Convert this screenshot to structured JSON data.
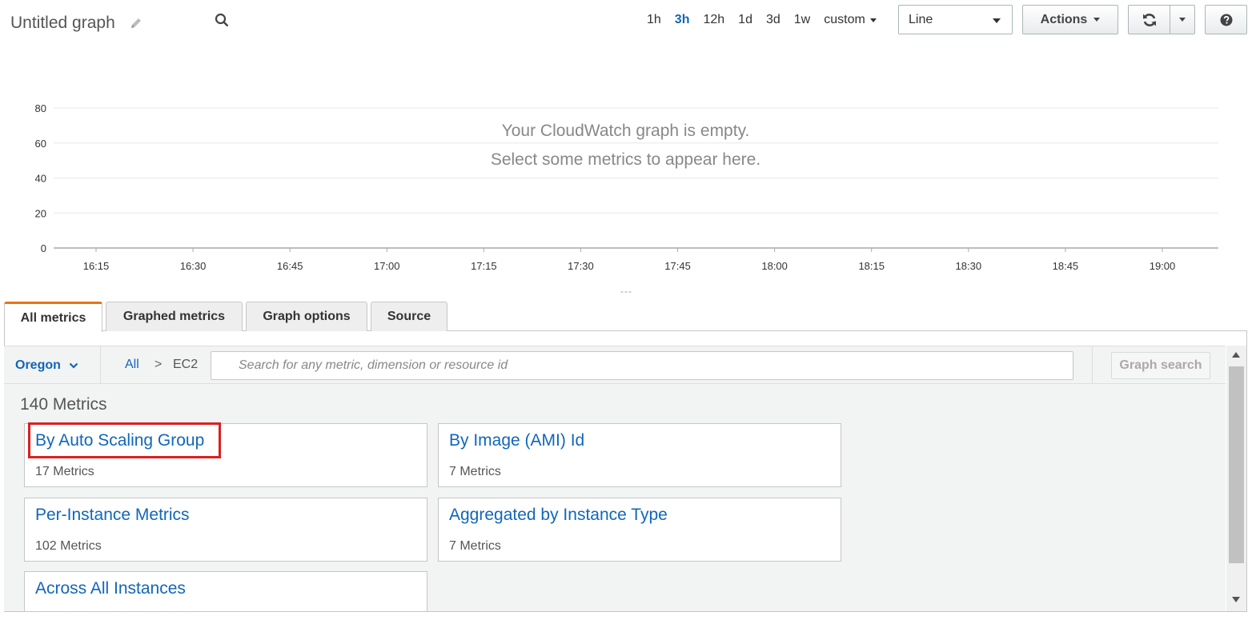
{
  "header": {
    "title": "Untitled graph",
    "time_ranges": [
      "1h",
      "3h",
      "12h",
      "1d",
      "3d",
      "1w"
    ],
    "active_range": "3h",
    "custom_label": "custom",
    "graph_type": "Line",
    "actions_label": "Actions"
  },
  "chart": {
    "empty_line1": "Your CloudWatch graph is empty.",
    "empty_line2": "Select some metrics to appear here.",
    "y_ticks": [
      "80",
      "60",
      "40",
      "20",
      "0"
    ],
    "x_ticks": [
      "16:15",
      "16:30",
      "16:45",
      "17:00",
      "17:15",
      "17:30",
      "17:45",
      "18:00",
      "18:15",
      "18:30",
      "18:45",
      "19:00"
    ],
    "drag_handle": "---"
  },
  "tabs": [
    "All metrics",
    "Graphed metrics",
    "Graph options",
    "Source"
  ],
  "toolbar": {
    "region": "Oregon",
    "crumb_all": "All",
    "crumb_sep": ">",
    "crumb_current": "EC2",
    "search_placeholder": "Search for any metric, dimension or resource id",
    "graph_search": "Graph search"
  },
  "metrics": {
    "count": "140 Metrics",
    "cards": [
      {
        "title": "By Auto Scaling Group",
        "sub": "17 Metrics"
      },
      {
        "title": "By Image (AMI) Id",
        "sub": "7 Metrics"
      },
      {
        "title": "Per-Instance Metrics",
        "sub": "102 Metrics"
      },
      {
        "title": "Aggregated by Instance Type",
        "sub": "7 Metrics"
      },
      {
        "title": "Across All Instances",
        "sub": ""
      }
    ]
  },
  "colors": {
    "link": "#1166bb",
    "tab_accent": "#ec7211",
    "highlight": "#dd1e1e"
  }
}
